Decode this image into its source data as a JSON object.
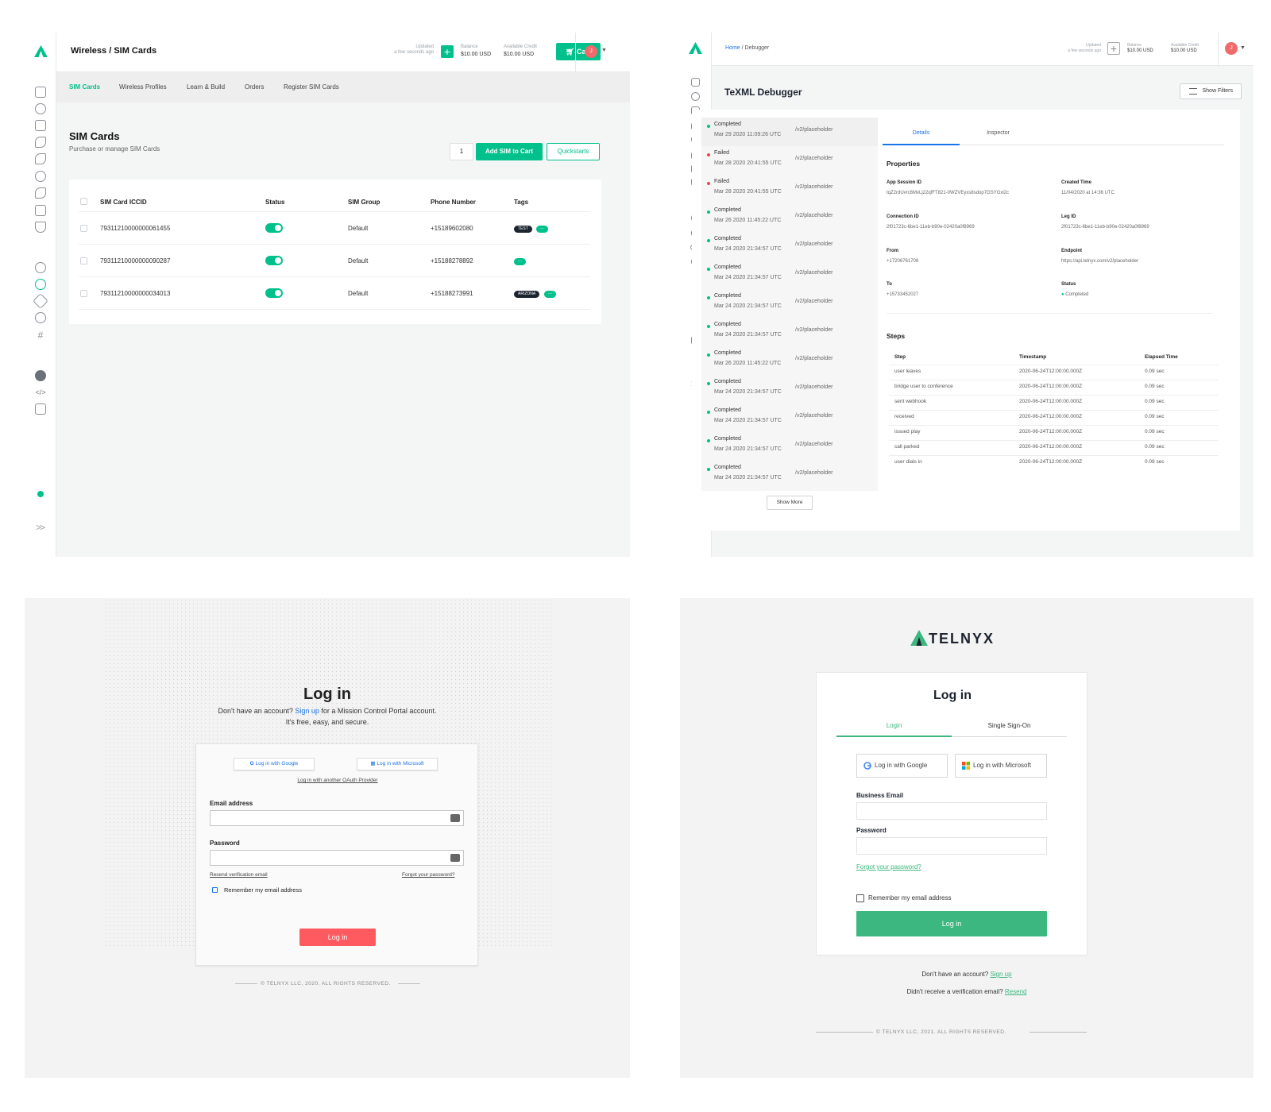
{
  "sim_panel": {
    "title": "Wireless / SIM Cards",
    "header": {
      "updated_label": "Updated",
      "updated_value": "a few seconds ago",
      "balance_label": "Balance",
      "balance_value": "$10.00 USD",
      "credit_label": "Available Credit",
      "credit_value": "$10.00 USD",
      "cart_label": "Cart",
      "avatar_initial": "J"
    },
    "tabs": [
      "SIM Cards",
      "Wireless Profiles",
      "Learn & Build",
      "Orders",
      "Register SIM Cards"
    ],
    "heading": "SIM Cards",
    "subheading": "Purchase or manage SIM Cards",
    "quantity": "1",
    "add_button": "Add SIM to Cart",
    "quickstarts_button": "Quickstarts",
    "columns": [
      "SIM Card ICCID",
      "Status",
      "SIM Group",
      "Phone Number",
      "Tags"
    ],
    "rows": [
      {
        "iccid": "79311210000000061455",
        "group": "Default",
        "phone": "+15189602080",
        "tag": "TEST",
        "more": "..."
      },
      {
        "iccid": "79311210000000090287",
        "group": "Default",
        "phone": "+15188278892",
        "tag": "",
        "more": "..."
      },
      {
        "iccid": "79311210000000034013",
        "group": "Default",
        "phone": "+15188273991",
        "tag": "ARIZONA",
        "more": "..."
      }
    ]
  },
  "debugger_panel": {
    "breadcrumb_home": "Home",
    "breadcrumb_current": " / Debugger",
    "header": {
      "updated_label": "Updated",
      "updated_value": "a few seconds ago",
      "balance_label": "Balance",
      "balance_value": "$10.00 USD",
      "credit_label": "Available Credit",
      "credit_value": "$10.00 USD",
      "avatar_initial": "J"
    },
    "title": "TeXML Debugger",
    "show_filters": "Show Filters",
    "logs": [
      {
        "status": "Completed",
        "time": "Mar 29 2020 11:09:26 UTC",
        "path": "/v2/placeholder"
      },
      {
        "status": "Failed",
        "time": "Mar 28 2020 20:41:55 UTC",
        "path": "/v2/placeholder"
      },
      {
        "status": "Failed",
        "time": "Mar 28 2020 20:41:55 UTC",
        "path": "/v2/placeholder"
      },
      {
        "status": "Completed",
        "time": "Mar 26 2020 11:45:22 UTC",
        "path": "/v2/placeholder"
      },
      {
        "status": "Completed",
        "time": "Mar 24 2020 21:34:57 UTC",
        "path": "/v2/placeholder"
      },
      {
        "status": "Completed",
        "time": "Mar 24 2020 21:34:57 UTC",
        "path": "/v2/placeholder"
      },
      {
        "status": "Completed",
        "time": "Mar 24 2020 21:34:57 UTC",
        "path": "/v2/placeholder"
      },
      {
        "status": "Completed",
        "time": "Mar 24 2020 21:34:57 UTC",
        "path": "/v2/placeholder"
      },
      {
        "status": "Completed",
        "time": "Mar 26 2020 11:45:22 UTC",
        "path": "/v2/placeholder"
      },
      {
        "status": "Completed",
        "time": "Mar 24 2020 21:34:57 UTC",
        "path": "/v2/placeholder"
      },
      {
        "status": "Completed",
        "time": "Mar 24 2020 21:34:57 UTC",
        "path": "/v2/placeholder"
      },
      {
        "status": "Completed",
        "time": "Mar 24 2020 21:34:57 UTC",
        "path": "/v2/placeholder"
      },
      {
        "status": "Completed",
        "time": "Mar 24 2020 21:34:57 UTC",
        "path": "/v2/placeholder"
      }
    ],
    "show_more": "Show More",
    "tabs": [
      "Details",
      "Inspector"
    ],
    "properties_heading": "Properties",
    "properties": {
      "app_session_id_label": "App Session ID",
      "app_session_id": "tqZ2rdUvrc6MvLj22qfFT821-0WZVEyxs8sdop7GSYGxl2c",
      "created_time_label": "Created Time",
      "created_time": "11/04/2020 at 14:36 UTC",
      "connection_id_label": "Connection ID",
      "connection_id": "2f01723c-6be1-11eb-b90e-02420a0f8969",
      "leg_id_label": "Leg ID",
      "leg_id": "2f01723c-6be1-11eb-b90e-02420a0f8969",
      "from_label": "From",
      "from": "+17206761708",
      "endpoint_label": "Endpoint",
      "endpoint": "https://api.telnyx.com/v2/placeholder",
      "to_label": "To",
      "to": "+15733452027",
      "status_label": "Status",
      "status": "Completed"
    },
    "steps_heading": "Steps",
    "steps_columns": [
      "Step",
      "Timestamp",
      "Elapsed Time"
    ],
    "steps": [
      {
        "step": "user leaves",
        "timestamp": "2020-06-24T12:00:00.000Z",
        "elapsed": "0.09 sec"
      },
      {
        "step": "bridge user to conference",
        "timestamp": "2020-06-24T12:00:00.000Z",
        "elapsed": "0.09 sec"
      },
      {
        "step": "sent webhook",
        "timestamp": "2020-06-24T12:00:00.000Z",
        "elapsed": "0.09 sec"
      },
      {
        "step": "received",
        "timestamp": "2020-06-24T12:00:00.000Z",
        "elapsed": "0.09 sec"
      },
      {
        "step": "issued play",
        "timestamp": "2020-06-24T12:00:00.000Z",
        "elapsed": "0.09 sec"
      },
      {
        "step": "call parked",
        "timestamp": "2020-06-24T12:00:00.000Z",
        "elapsed": "0.09 sec"
      },
      {
        "step": "user dials in",
        "timestamp": "2020-06-24T12:00:00.000Z",
        "elapsed": "0.09 sec"
      }
    ]
  },
  "login_2020": {
    "heading": "Log in",
    "line1_prefix": "Don't have an account? ",
    "line1_link": "Sign up",
    "line1_suffix": " for a Mission Control Portal account.",
    "line2": "It's free, easy, and secure.",
    "google_button": "Log in with Google",
    "microsoft_button": "Log in with Microsoft",
    "other_oauth": "Log in with another OAuth Provider",
    "email_label": "Email address",
    "password_label": "Password",
    "resend_link": "Resend verification email",
    "forgot_link": "Forgot your password?",
    "remember_label": "Remember my email address",
    "login_button": "Log in",
    "footer": "© TELNYX LLC, 2020. ALL RIGHTS RESERVED."
  },
  "login_2021": {
    "brand": "TELNYX",
    "heading": "Log in",
    "tabs": [
      "Login",
      "Single Sign-On"
    ],
    "google_button": "Log in with Google",
    "microsoft_button": "Log in with Microsoft",
    "email_label": "Business Email",
    "password_label": "Password",
    "forgot_link": "Forgot your password?",
    "remember_label": "Remember my email address",
    "login_button": "Log in",
    "signup_prefix": "Don't have an account? ",
    "signup_link": "Sign up",
    "resend_prefix": "Didn't receive a verification email? ",
    "resend_link": "Resend",
    "footer": "© TELNYX LLC, 2021. ALL RIGHTS RESERVED."
  },
  "colors": {
    "brand_green": "#00c08b",
    "login_green": "#3cb77f",
    "failed_red": "#e5484d",
    "login_red": "#ff5a5f",
    "link_blue": "#1a73e8"
  },
  "icons": [
    "telnyx-logo-icon",
    "billing-icon",
    "numbers-icon",
    "messaging-icon",
    "voice-icon",
    "call-control-icon",
    "sip-icon",
    "fax-icon",
    "document-icon",
    "shield-icon",
    "reports-icon",
    "debugger-icon",
    "integrations-icon",
    "storage-icon",
    "hash-icon",
    "help-icon",
    "code-icon",
    "docs-icon",
    "status-dot-icon",
    "expand-icon",
    "cart-icon",
    "plus-icon",
    "filter-icon",
    "google-icon",
    "microsoft-icon",
    "autofill-icon"
  ]
}
